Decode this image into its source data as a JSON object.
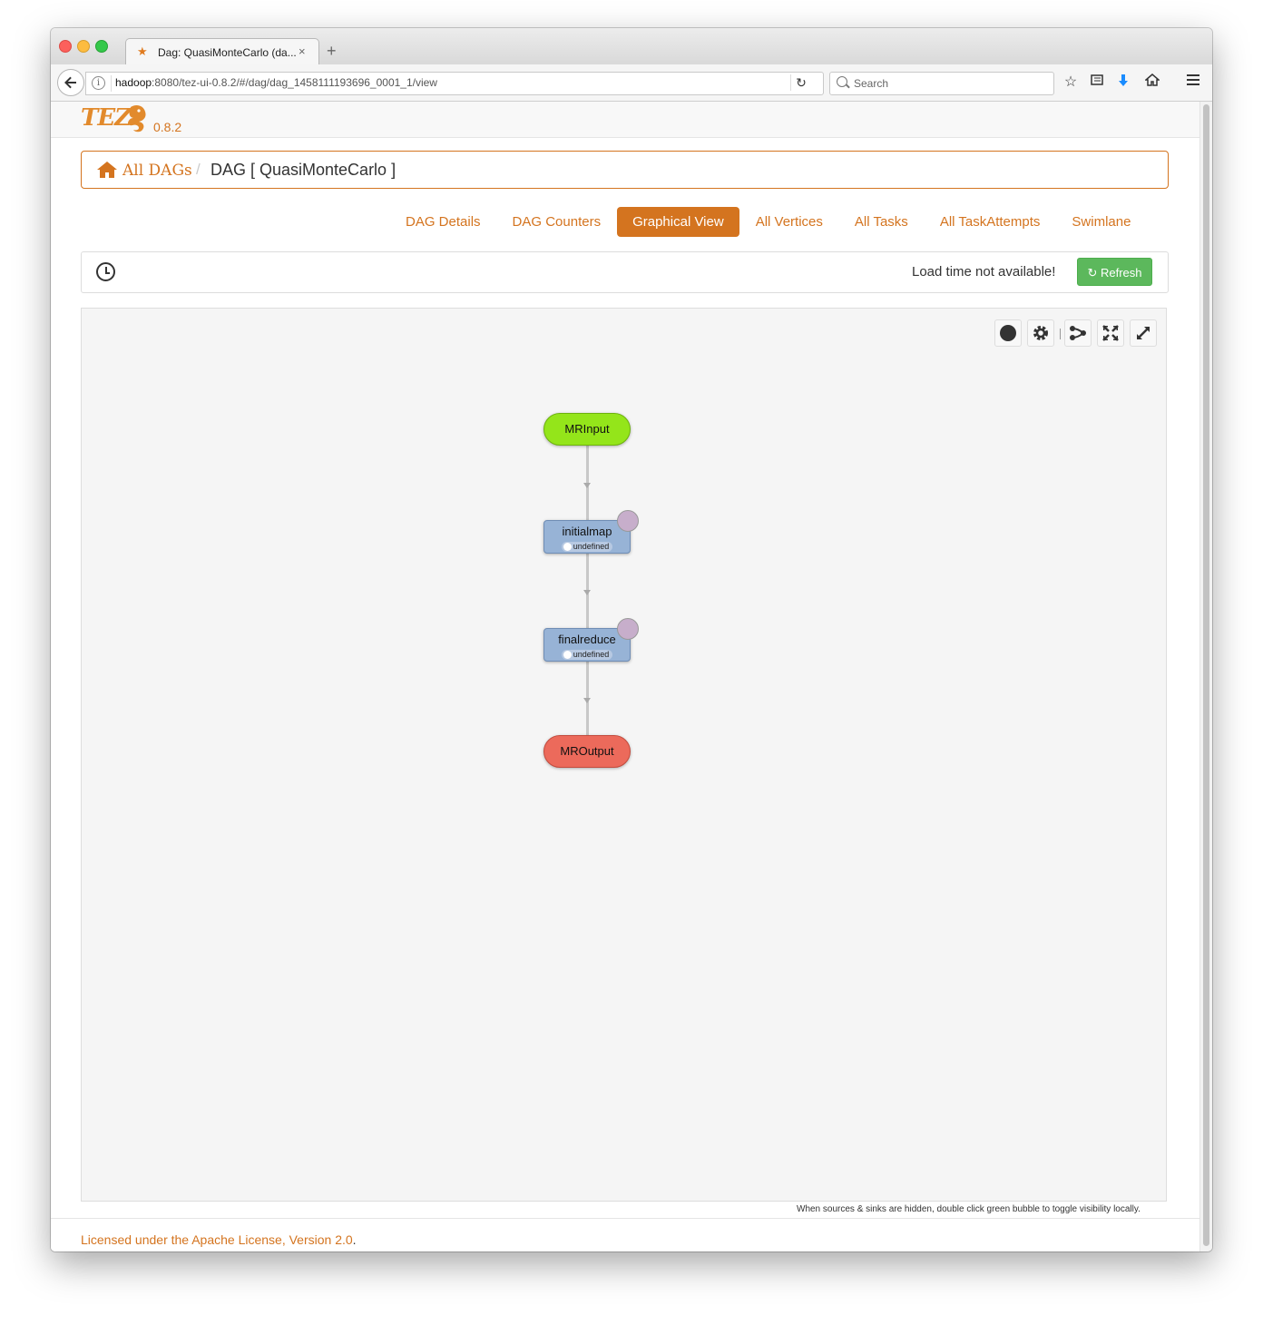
{
  "browser": {
    "tab_title": "Dag: QuasiMonteCarlo (da...",
    "tab_close": "×",
    "new_tab": "+",
    "url_host": "hadoop",
    "url_rest": ":8080/tez-ui-0.8.2/#/dag/dag_1458111193696_0001_1/view",
    "search_placeholder": "Search",
    "toolbar_icons": [
      "bookmark-star-icon",
      "reading-list-icon",
      "download-icon",
      "home-icon",
      "menu-icon"
    ]
  },
  "app": {
    "logo_text": "TEZ",
    "version": "0.8.2"
  },
  "breadcrumb": {
    "home_label": "All DAGs",
    "separator": "/",
    "current": "DAG [ QuasiMonteCarlo ]"
  },
  "tabs": [
    {
      "label": "DAG Details",
      "active": false
    },
    {
      "label": "DAG Counters",
      "active": false
    },
    {
      "label": "Graphical View",
      "active": true
    },
    {
      "label": "All Vertices",
      "active": false
    },
    {
      "label": "All Tasks",
      "active": false
    },
    {
      "label": "All TaskAttempts",
      "active": false
    },
    {
      "label": "Swimlane",
      "active": false
    }
  ],
  "load_panel": {
    "load_text": "Load time not available!",
    "refresh_label": "Refresh"
  },
  "graph": {
    "controls": [
      "record-icon",
      "settings-gear-icon",
      "orientation-share-icon",
      "fit-screen-icon",
      "fullscreen-icon"
    ],
    "nodes": {
      "source": {
        "name": "MRInput",
        "color": "#94e51a"
      },
      "vertex1": {
        "name": "initialmap",
        "status": "undefined"
      },
      "vertex2": {
        "name": "finalreduce",
        "status": "undefined"
      },
      "sink": {
        "name": "MROutput",
        "color": "#ec6a5b"
      }
    },
    "hint": "When sources & sinks are hidden, double click green bubble to toggle visibility locally."
  },
  "footer": {
    "license_text": "Licensed under the Apache License, Version 2.0",
    "period": "."
  },
  "colors": {
    "accent": "#d4741f",
    "refresh_green": "#5cb85c",
    "vertex_blue": "#97b3d6"
  }
}
